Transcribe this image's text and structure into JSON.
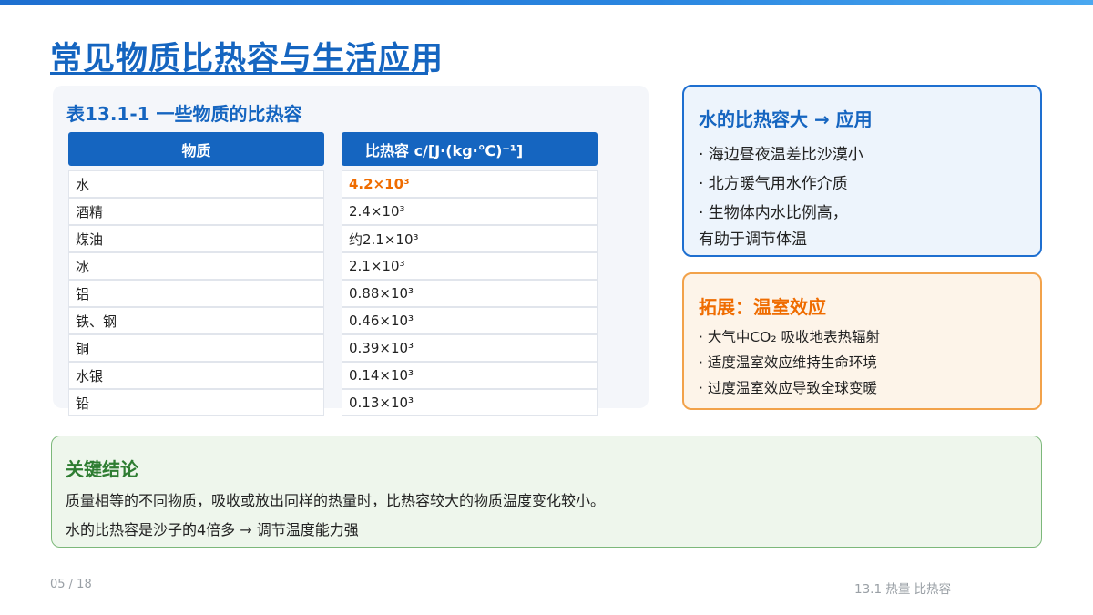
{
  "title": "常见物质比热容与生活应用",
  "table": {
    "caption": "表13.1-1 一些物质的比热容",
    "headers": [
      "物质",
      "比热容 c/[J·(kg·℃)⁻¹]"
    ],
    "rows": [
      [
        "水",
        "4.2×10³"
      ],
      [
        "酒精",
        "2.4×10³"
      ],
      [
        "煤油",
        "约2.1×10³"
      ],
      [
        "冰",
        "2.1×10³"
      ],
      [
        "铝",
        "0.88×10³"
      ],
      [
        "铁、钢",
        "0.46×10³"
      ],
      [
        "铜",
        "0.39×10³"
      ],
      [
        "水银",
        "0.14×10³"
      ],
      [
        "铅",
        "0.13×10³"
      ]
    ]
  },
  "water_box": {
    "title": "水的比热容大 → 应用",
    "items": [
      "· 海边昼夜温差比沙漠小",
      "· 北方暖气用水作介质",
      "· 生物体内水比例高，",
      "有助于调节体温"
    ]
  },
  "extension_box": {
    "title": "拓展：温室效应",
    "items": [
      "· 大气中CO₂ 吸收地表热辐射",
      "· 适度温室效应维持生命环境",
      "· 过度温室效应导致全球变暖"
    ]
  },
  "conclusion": {
    "title": "关键结论",
    "lines": [
      "质量相等的不同物质，吸收或放出同样的热量时，比热容较大的物质温度变化较小。",
      "水的比热容是沙子的4倍多 → 调节温度能力强"
    ]
  },
  "footer": {
    "page": "05 / 18",
    "section": "13.1 热量 比热容"
  },
  "colors": {
    "primary": "#1565c0",
    "highlight": "#ef6c00",
    "conclusion": "#2e7d32"
  }
}
